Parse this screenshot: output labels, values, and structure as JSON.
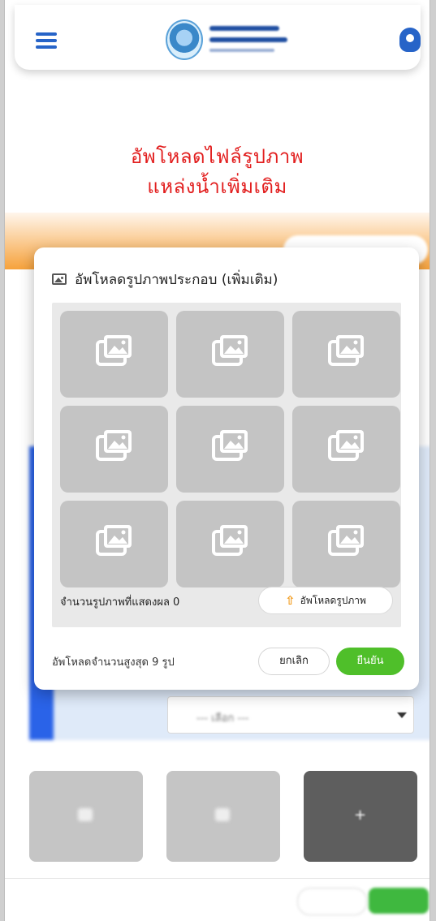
{
  "page": {
    "title_line1": "อัพโหลดไฟล์รูปภาพ",
    "title_line2": "แหล่งน้ำเพิ่มเติม"
  },
  "colors": {
    "brand_blue": "#2764c8",
    "title_red": "#e21f1f",
    "confirm_green": "#4fbf2a",
    "upload_orange": "#f29a1a"
  },
  "header": {
    "menu_icon": "hamburger-menu-icon",
    "logo_icon": "agency-seal-logo",
    "user_icon": "user-account-icon"
  },
  "modal": {
    "title": "อัพโหลดรูปภาพประกอบ (เพิ่มเติม)",
    "title_icon": "image-icon",
    "placeholder_icon": "image-placeholder-icon",
    "slot_count": 9,
    "count_label": "จำนวนรูปภาพที่แสดงผล 0",
    "upload_label": "อัพโหลดรูปภาพ",
    "upload_icon": "upload-icon",
    "max_label": "อัพโหลดจำนวนสูงสุด 9 รูป",
    "cancel_label": "ยกเลิก",
    "confirm_label": "ยืนยัน"
  },
  "background_form": {
    "dropdown_placeholder": "--- เลือก ---"
  }
}
